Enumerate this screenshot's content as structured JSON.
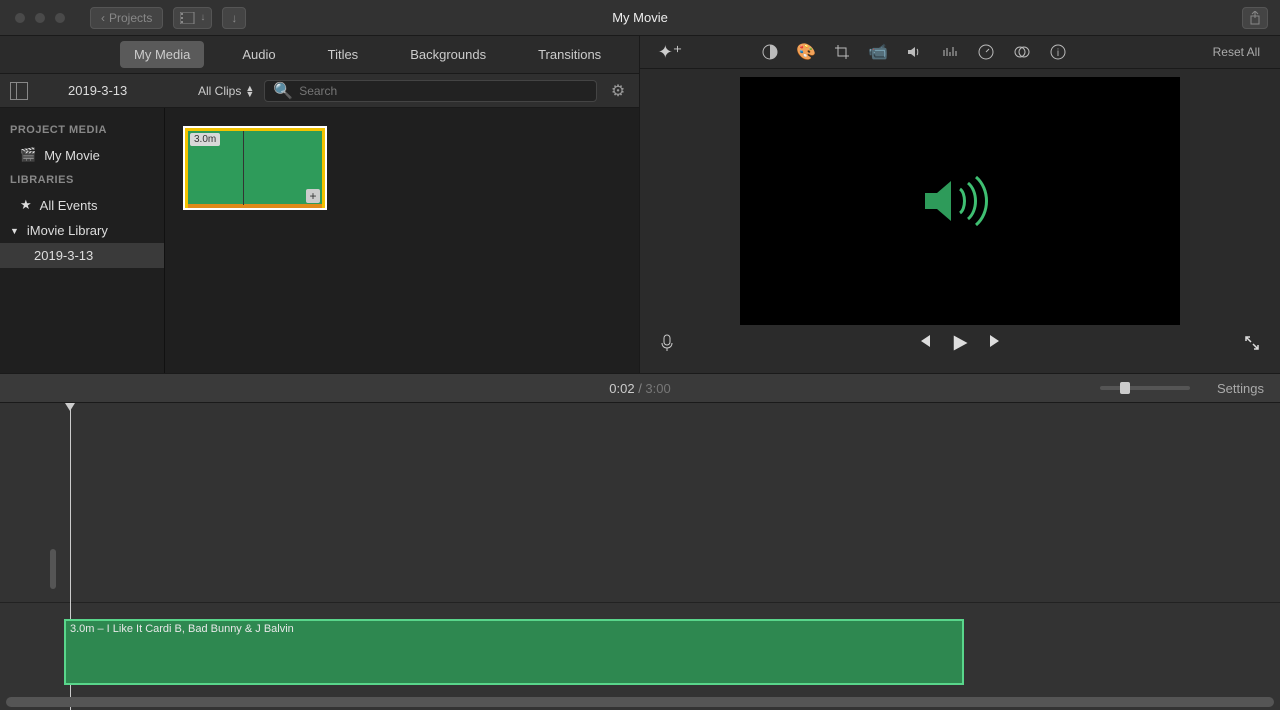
{
  "titlebar": {
    "back_label": "Projects",
    "title": "My Movie"
  },
  "tabs": {
    "my_media": "My Media",
    "audio": "Audio",
    "titles": "Titles",
    "backgrounds": "Backgrounds",
    "transitions": "Transitions"
  },
  "adjust_panel": {
    "reset_label": "Reset All"
  },
  "browser": {
    "event_name": "2019-3-13",
    "filter_label": "All Clips",
    "search_placeholder": "Search"
  },
  "sidebar": {
    "heading_project": "PROJECT MEDIA",
    "project_item": "My Movie",
    "heading_libraries": "LIBRARIES",
    "all_events": "All Events",
    "library_name": "iMovie Library",
    "event_item": "2019-3-13"
  },
  "clip": {
    "duration_badge": "3.0m"
  },
  "playback": {
    "current_time": "0:02",
    "total_time": "3:00",
    "settings_label": "Settings"
  },
  "timeline_clip": {
    "label": "3.0m – I Like It Cardi B, Bad Bunny & J Balvin"
  },
  "colors": {
    "clip_green": "#2e9b5a",
    "accent_green": "#3fbf72"
  }
}
